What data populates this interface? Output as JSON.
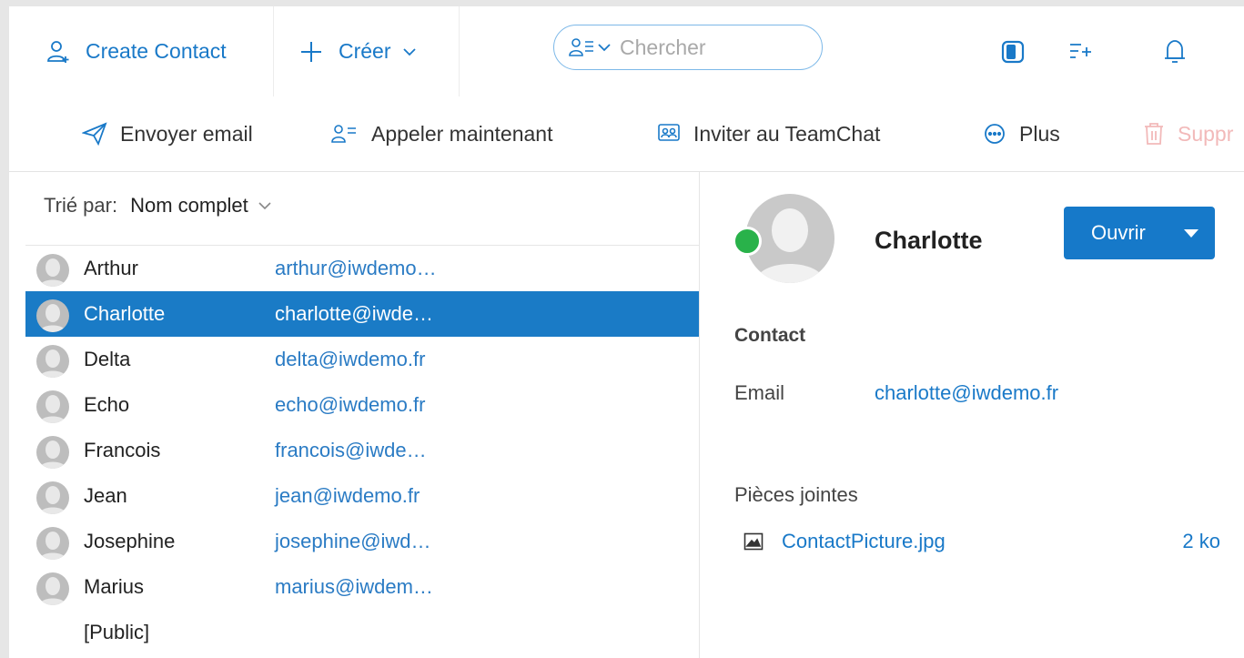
{
  "toolbar": {
    "create_contact": "Create Contact",
    "create": "Créer",
    "search_placeholder": "Chercher"
  },
  "actions": {
    "send_email": "Envoyer email",
    "call_now": "Appeler maintenant",
    "invite_teamchat": "Inviter au TeamChat",
    "more": "Plus",
    "delete": "Suppr"
  },
  "list": {
    "sort_label": "Trié par:",
    "sort_value": "Nom complet",
    "contacts": [
      {
        "name": "Arthur",
        "email": "arthur@iwdemo…"
      },
      {
        "name": "Charlotte",
        "email": "charlotte@iwde…"
      },
      {
        "name": "Delta",
        "email": "delta@iwdemo.fr"
      },
      {
        "name": "Echo",
        "email": "echo@iwdemo.fr"
      },
      {
        "name": "Francois",
        "email": "francois@iwde…"
      },
      {
        "name": "Jean",
        "email": "jean@iwdemo.fr"
      },
      {
        "name": "Josephine",
        "email": "josephine@iwd…"
      },
      {
        "name": "Marius",
        "email": "marius@iwdem…"
      },
      {
        "name": "[Public]",
        "email": ""
      }
    ],
    "selected_index": 1
  },
  "detail": {
    "name": "Charlotte",
    "open_button": "Ouvrir",
    "section_title": "Contact",
    "email_label": "Email",
    "email_value": "charlotte@iwdemo.fr",
    "attachments_title": "Pièces jointes",
    "attachment_name": "ContactPicture.jpg",
    "attachment_size": "2 ko",
    "status_color": "#29b24a"
  },
  "colors": {
    "accent": "#1979c8",
    "selected_row": "#1a7bc6"
  }
}
